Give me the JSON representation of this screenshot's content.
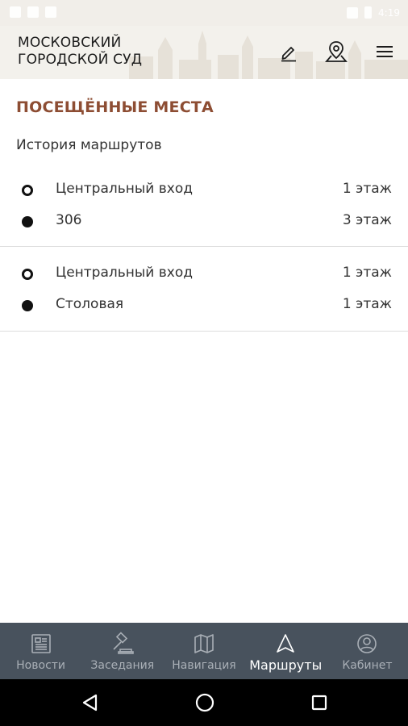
{
  "status_bar": {
    "left_icons": [
      "notification-icon",
      "warning-icon",
      "play-icon"
    ],
    "right_icons": [
      "vibrate-icon",
      "battery-icon"
    ],
    "time": "4:19"
  },
  "header": {
    "brand_line1": "МОСКОВСКИЙ",
    "brand_line2": "ГОРОДСКОЙ СУД",
    "actions": [
      "edit-icon",
      "map-pin-icon",
      "menu-icon"
    ]
  },
  "page": {
    "title": "ПОСЕЩЁННЫЕ МЕСТА",
    "subtitle": "История маршрутов"
  },
  "routes": [
    {
      "stops": [
        {
          "name": "Центральный вход",
          "floor": "1 этаж",
          "marker": "start"
        },
        {
          "name": "306",
          "floor": "3 этаж",
          "marker": "end"
        }
      ]
    },
    {
      "stops": [
        {
          "name": "Центральный вход",
          "floor": "1 этаж",
          "marker": "start"
        },
        {
          "name": "Столовая",
          "floor": "1 этаж",
          "marker": "end"
        }
      ]
    }
  ],
  "bottom_nav": {
    "items": [
      {
        "label": "Новости",
        "icon": "newspaper-icon",
        "active": false
      },
      {
        "label": "Заседания",
        "icon": "gavel-icon",
        "active": false
      },
      {
        "label": "Навигация",
        "icon": "map-icon",
        "active": false
      },
      {
        "label": "Маршруты",
        "icon": "navigation-arrow-icon",
        "active": true
      },
      {
        "label": "Кабинет",
        "icon": "user-circle-icon",
        "active": false
      }
    ]
  },
  "system_nav": [
    "back-icon",
    "home-icon",
    "recents-icon"
  ],
  "colors": {
    "accent": "#8d4d33",
    "nav_background": "#48525d",
    "nav_inactive": "#a9afb6",
    "nav_active": "#ffffff"
  }
}
